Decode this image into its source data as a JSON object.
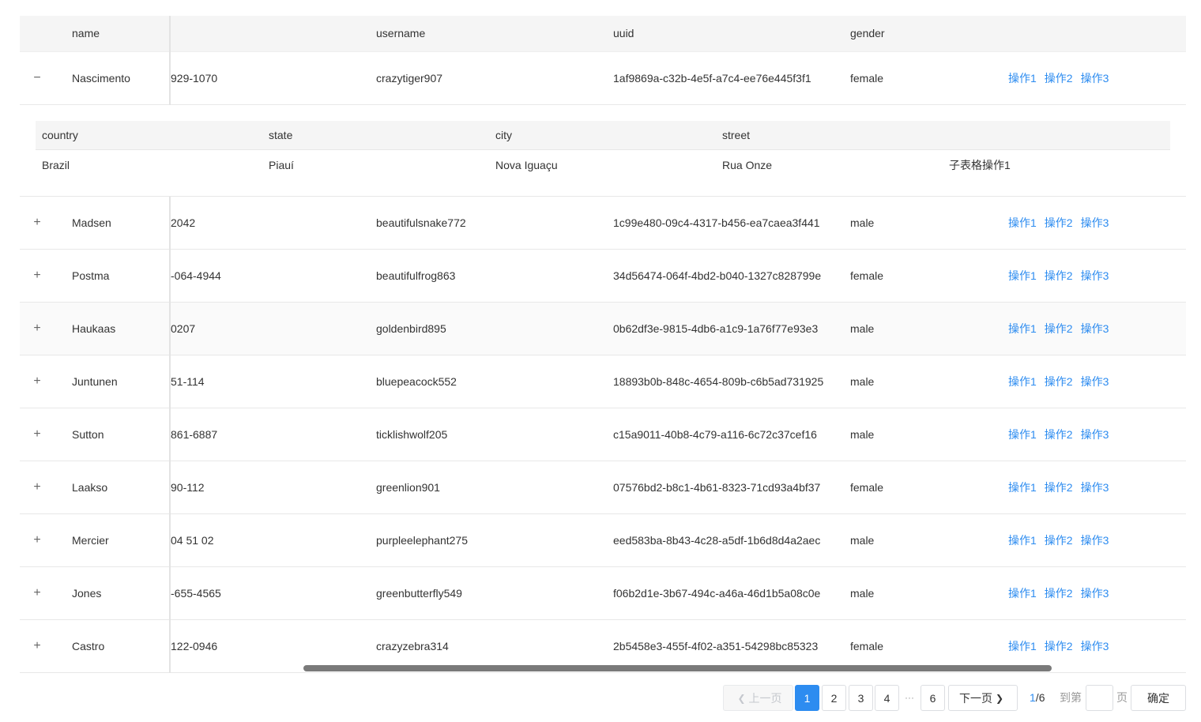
{
  "columns": {
    "name": "name",
    "username": "username",
    "uuid": "uuid",
    "gender": "gender"
  },
  "ops": {
    "op1": "操作1",
    "op2": "操作2",
    "op3": "操作3"
  },
  "rows": [
    {
      "expand": "−",
      "name": "Nascimento",
      "phone": "929-1070",
      "username": "crazytiger907",
      "uuid": "1af9869a-c32b-4e5f-a7c4-ee76e445f3f1",
      "gender": "female"
    },
    {
      "expand": "+",
      "name": "Madsen",
      "phone": "2042",
      "username": "beautifulsnake772",
      "uuid": "1c99e480-09c4-4317-b456-ea7caea3f441",
      "gender": "male"
    },
    {
      "expand": "+",
      "name": "Postma",
      "phone": "-064-4944",
      "username": "beautifulfrog863",
      "uuid": "34d56474-064f-4bd2-b040-1327c828799e",
      "gender": "female"
    },
    {
      "expand": "+",
      "name": "Haukaas",
      "phone": "0207",
      "username": "goldenbird895",
      "uuid": "0b62df3e-9815-4db6-a1c9-1a76f77e93e3",
      "gender": "male"
    },
    {
      "expand": "+",
      "name": "Juntunen",
      "phone": "51-114",
      "username": "bluepeacock552",
      "uuid": "18893b0b-848c-4654-809b-c6b5ad731925",
      "gender": "male"
    },
    {
      "expand": "+",
      "name": "Sutton",
      "phone": "861-6887",
      "username": "ticklishwolf205",
      "uuid": "c15a9011-40b8-4c79-a116-6c72c37cef16",
      "gender": "male"
    },
    {
      "expand": "+",
      "name": "Laakso",
      "phone": "90-112",
      "username": "greenlion901",
      "uuid": "07576bd2-b8c1-4b61-8323-71cd93a4bf37",
      "gender": "female"
    },
    {
      "expand": "+",
      "name": "Mercier",
      "phone": "04 51 02",
      "username": "purpleelephant275",
      "uuid": "eed583ba-8b43-4c28-a5df-1b6d8d4a2aec",
      "gender": "male"
    },
    {
      "expand": "+",
      "name": "Jones",
      "phone": "-655-4565",
      "username": "greenbutterfly549",
      "uuid": "f06b2d1e-3b67-494c-a46a-46d1b5a08c0e",
      "gender": "male"
    },
    {
      "expand": "+",
      "name": "Castro",
      "phone": "122-0946",
      "username": "crazyzebra314",
      "uuid": "2b5458e3-455f-4f02-a351-54298bc85323",
      "gender": "female"
    }
  ],
  "subtable": {
    "columns": {
      "country": "country",
      "state": "state",
      "city": "city",
      "street": "street"
    },
    "row": {
      "country": "Brazil",
      "state": "Piauí",
      "city": "Nova Iguaçu",
      "street": "Rua Onze",
      "op": "子表格操作1"
    }
  },
  "pagination": {
    "prev": "上一页",
    "next": "下一页",
    "pages": [
      "1",
      "2",
      "3",
      "4",
      "6"
    ],
    "ellipsis": "···",
    "current": "1",
    "total": "6",
    "slash": "/",
    "goto": "到第",
    "page_unit": "页",
    "jump_value": "",
    "confirm": "确定"
  },
  "colors": {
    "accent": "#2d8cf0",
    "header_bg": "#f5f5f5",
    "border": "#e8e8e8"
  }
}
